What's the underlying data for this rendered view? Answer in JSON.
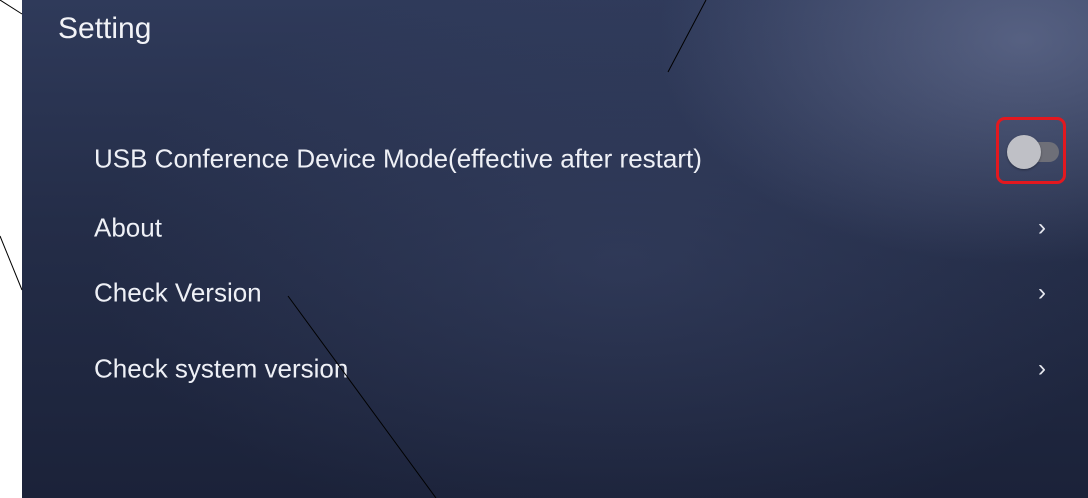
{
  "header": {
    "title": "Setting"
  },
  "settings": {
    "items": [
      {
        "label": "USB Conference Device Mode(effective after restart)",
        "control": "toggle",
        "toggle_on": false
      },
      {
        "label": "About",
        "control": "chevron",
        "chevron": "›"
      },
      {
        "label": "Check Version",
        "control": "chevron",
        "chevron": "›"
      },
      {
        "label": "Check system version",
        "control": "chevron",
        "chevron": "›"
      }
    ]
  },
  "highlight": {
    "color": "#e3181f"
  },
  "icons": [
    "toggle-switch-icon",
    "chevron-right-icon"
  ]
}
